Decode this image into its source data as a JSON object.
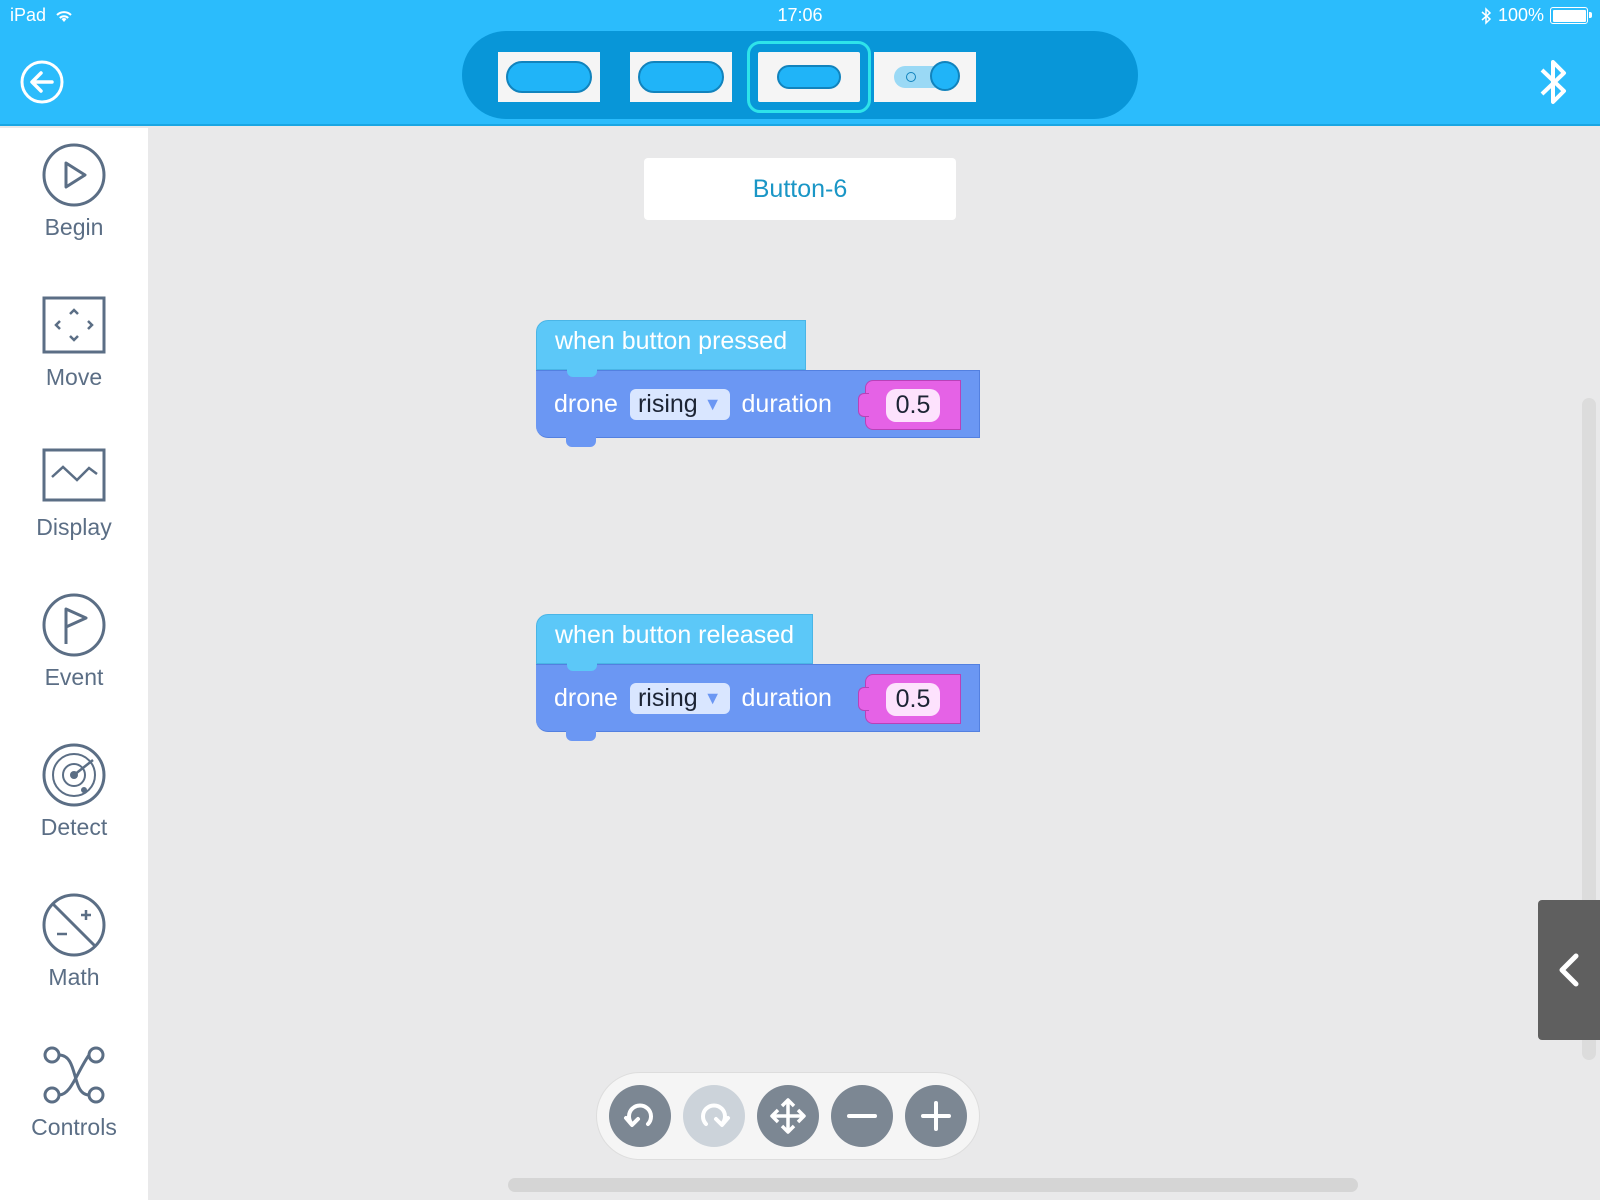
{
  "status_bar": {
    "device": "iPad",
    "time": "17:06",
    "battery": "100%"
  },
  "header": {
    "back_icon": "back-arrow-icon",
    "bluetooth_icon": "bluetooth-icon",
    "accent": "#2bbcfc"
  },
  "widgets": [
    {
      "type": "button",
      "selected": false
    },
    {
      "type": "button",
      "selected": false
    },
    {
      "type": "button",
      "selected": true
    },
    {
      "type": "switch",
      "selected": false
    }
  ],
  "sidebar": {
    "items": [
      {
        "label": "Begin",
        "icon": "play-circle-icon"
      },
      {
        "label": "Move",
        "icon": "move-frame-icon"
      },
      {
        "label": "Display",
        "icon": "display-wave-icon"
      },
      {
        "label": "Event",
        "icon": "flag-circle-icon"
      },
      {
        "label": "Detect",
        "icon": "radar-icon"
      },
      {
        "label": "Math",
        "icon": "math-circle-icon"
      },
      {
        "label": "Controls",
        "icon": "controls-nodes-icon"
      }
    ]
  },
  "workspace": {
    "title": "Button-6",
    "blocks": [
      {
        "hat": "when button pressed",
        "cmd": "drone",
        "dropdown": "rising",
        "param": "duration",
        "value": "0.5"
      },
      {
        "hat": "when button released",
        "cmd": "drone",
        "dropdown": "rising",
        "param": "duration",
        "value": "0.5"
      }
    ]
  },
  "toolbar": [
    "undo-icon",
    "redo-icon",
    "move-icon",
    "zoom-out-icon",
    "zoom-in-icon"
  ]
}
